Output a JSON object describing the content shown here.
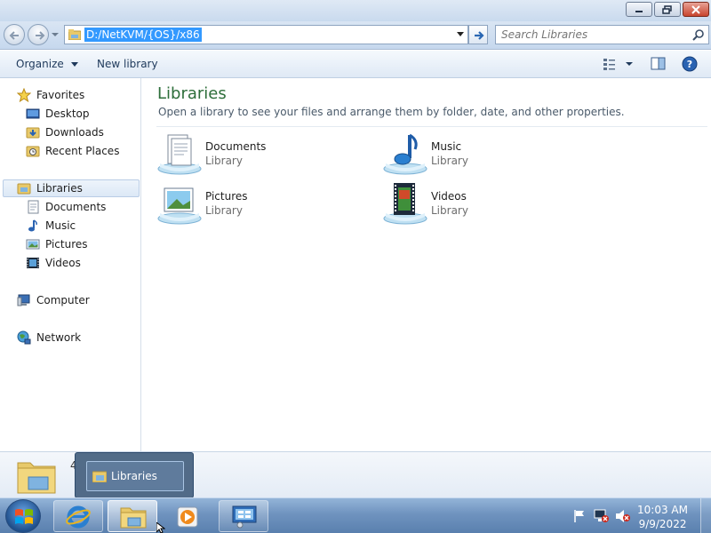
{
  "window": {
    "minimize_icon": "minimize-icon",
    "maximize_icon": "restore-icon",
    "close_icon": "close-icon"
  },
  "navbar": {
    "address_value": "D:/NetKVM/{OS}/x86",
    "search_placeholder": "Search Libraries"
  },
  "commandbar": {
    "organize_label": "Organize",
    "new_library_label": "New library"
  },
  "navpane": {
    "favorites": {
      "label": "Favorites",
      "items": [
        {
          "label": "Desktop"
        },
        {
          "label": "Downloads"
        },
        {
          "label": "Recent Places"
        }
      ]
    },
    "libraries": {
      "label": "Libraries",
      "items": [
        {
          "label": "Documents"
        },
        {
          "label": "Music"
        },
        {
          "label": "Pictures"
        },
        {
          "label": "Videos"
        }
      ]
    },
    "computer_label": "Computer",
    "network_label": "Network"
  },
  "content": {
    "title": "Libraries",
    "subtitle": "Open a library to see your files and arrange them by folder, date, and other properties.",
    "libraries": [
      {
        "name": "Documents",
        "type": "Library"
      },
      {
        "name": "Music",
        "type": "Library"
      },
      {
        "name": "Pictures",
        "type": "Library"
      },
      {
        "name": "Videos",
        "type": "Library"
      }
    ]
  },
  "details": {
    "count": "4"
  },
  "thumbnail": {
    "label": "Libraries"
  },
  "taskbar": {
    "time": "10:03 AM",
    "date": "9/9/2022"
  },
  "colors": {
    "accent_selection": "#3399ff",
    "title_green": "#2d6e3a",
    "taskbar": "#6f93bf"
  }
}
